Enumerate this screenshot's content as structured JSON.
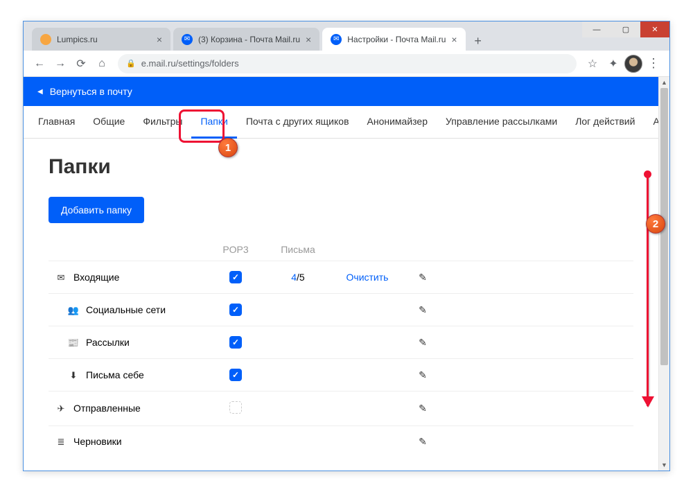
{
  "window": {
    "min": "—",
    "max": "▢",
    "close": "✕"
  },
  "tabs": [
    {
      "favicon_bg": "#f7a642",
      "title": "Lumpics.ru",
      "active": false
    },
    {
      "favicon_bg": "#005ff9",
      "favicon_glyph": "✉",
      "title": "(3) Корзина - Почта Mail.ru",
      "active": false
    },
    {
      "favicon_bg": "#005ff9",
      "favicon_glyph": "✉",
      "title": "Настройки - Почта Mail.ru",
      "active": true
    }
  ],
  "tab_add": "+",
  "nav": {
    "back": "←",
    "forward": "→",
    "reload": "⟳",
    "home": "⌂"
  },
  "address": {
    "lock": "🔒",
    "url": "e.mail.ru/settings/folders"
  },
  "toolbar_right": {
    "star": "☆",
    "ext": "✦",
    "menu": "⋮"
  },
  "back_to_mail": "Вернуться в почту",
  "settings_tabs": [
    {
      "label": "Главная",
      "active": false
    },
    {
      "label": "Общие",
      "active": false
    },
    {
      "label": "Фильтры",
      "active": false
    },
    {
      "label": "Папки",
      "active": true
    },
    {
      "label": "Почта с других ящиков",
      "active": false
    },
    {
      "label": "Анонимайзер",
      "active": false
    },
    {
      "label": "Управление рассылками",
      "active": false
    },
    {
      "label": "Лог действий",
      "active": false
    },
    {
      "label": "Аккаунт",
      "active": false
    }
  ],
  "page_title": "Папки",
  "add_folder_btn": "Добавить папку",
  "table_headers": {
    "pop3": "POP3",
    "letters": "Письма"
  },
  "folders": [
    {
      "icon": "✉",
      "name": "Входящие",
      "sub": false,
      "pop3": true,
      "letters_unread": "4",
      "letters_total": "/5",
      "clear": "Очистить",
      "edit": true
    },
    {
      "icon": "👥",
      "name": "Социальные сети",
      "sub": true,
      "pop3": true,
      "edit": true
    },
    {
      "icon": "📰",
      "name": "Рассылки",
      "sub": true,
      "pop3": true,
      "edit": true
    },
    {
      "icon": "⬇",
      "name": "Письма себе",
      "sub": true,
      "pop3": true,
      "edit": true
    },
    {
      "icon": "✈",
      "name": "Отправленные",
      "sub": false,
      "pop3": false,
      "pop3_off": true,
      "edit": true
    },
    {
      "icon": "≣",
      "name": "Черновики",
      "sub": false,
      "edit": true
    }
  ],
  "callouts": {
    "c1": "1",
    "c2": "2"
  }
}
